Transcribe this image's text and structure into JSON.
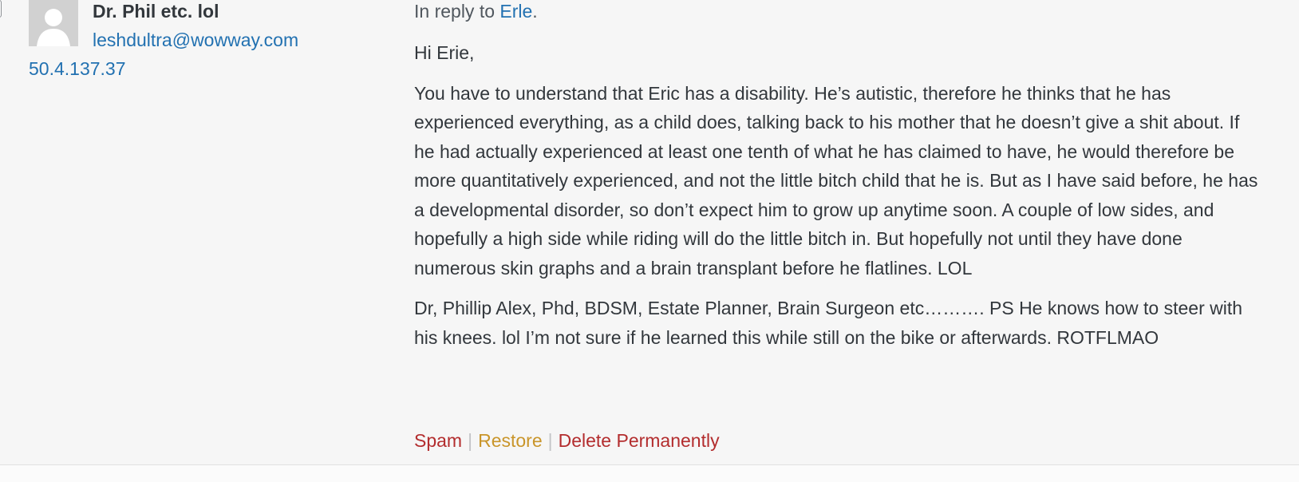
{
  "author": {
    "name": "Dr. Phil etc. lol",
    "email": "leshdultra@wowway.com",
    "ip": "50.4.137.37",
    "avatar_icon": "default-avatar-icon"
  },
  "comment": {
    "reply_prefix": "In reply to ",
    "reply_target": "Erle",
    "reply_suffix": ".",
    "paragraphs": [
      "Hi Erie,",
      "You have to understand that Eric has a disability. He’s autistic, therefore he thinks that he has experienced everything, as a child does, talking back to his mother that he doesn’t give a shit about. If he had actually experienced at least one tenth of what he has claimed to have, he would therefore be more quantitatively experienced, and not the little bitch child that he is. But as I have said before, he has a developmental disorder, so don’t expect him to grow up anytime soon. A couple of low sides, and hopefully a high side while riding will do the little bitch in. But hopefully not until they have done numerous skin graphs and a brain transplant before he flatlines. LOL",
      "Dr, Phillip Alex, Phd, BDSM, Estate Planner, Brain Surgeon etc………. PS He knows how to steer with his knees. lol I’m not sure if he learned this while still on the bike or afterwards. ROTFLMAO"
    ]
  },
  "actions": {
    "spam": "Spam",
    "separator": "|",
    "restore": "Restore",
    "delete": "Delete Permanently"
  },
  "colors": {
    "link": "#2271b1",
    "spam": "#b32d2e",
    "restore": "#c9952a",
    "delete": "#b32d2e",
    "background": "#f6f6f6"
  }
}
